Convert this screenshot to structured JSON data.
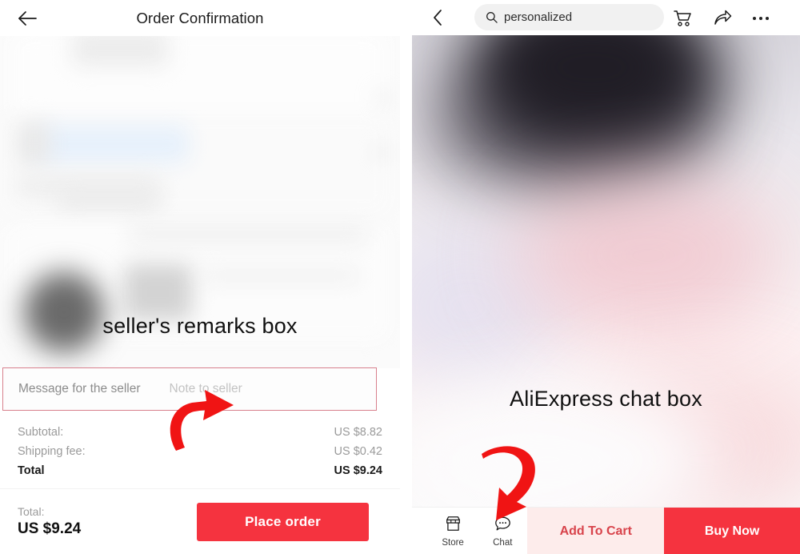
{
  "left_panel": {
    "header": {
      "back_icon": "back-arrow-icon",
      "title": "Order Confirmation"
    },
    "annotation_caption": "seller's remarks box",
    "note_field": {
      "label": "Message for the seller",
      "placeholder": "Note to seller",
      "value": "",
      "border_color": "#d8808d"
    },
    "totals": [
      {
        "label": "Subtotal:",
        "value": "US $8.82",
        "emphasis": false
      },
      {
        "label": "Shipping fee:",
        "value": "US $0.42",
        "emphasis": false
      },
      {
        "label": "Total",
        "value": "US $9.24",
        "emphasis": true
      }
    ],
    "footer": {
      "total_label": "Total:",
      "total_value": "US $9.24",
      "place_order_label": "Place order",
      "place_order_color": "#f5333f"
    },
    "arrow": {
      "name": "red-curved-arrow-up-right",
      "color": "#f01414"
    }
  },
  "right_panel": {
    "header": {
      "back_icon": "back-chevron-icon",
      "search": {
        "icon": "search-icon",
        "value": "personalized",
        "placeholder": "Search"
      },
      "cart_icon": "shopping-cart-icon",
      "share_icon": "share-icon",
      "more_icon": "more-options-icon"
    },
    "annotation_caption": "AliExpress chat box",
    "bottom_bar": {
      "store_icon": "store-icon",
      "store_label": "Store",
      "chat_icon": "chat-bubble-icon",
      "chat_label": "Chat",
      "add_to_cart_label": "Add To Cart",
      "add_to_cart_color": "#fdeceb",
      "add_to_cart_text_color": "#d8434b",
      "buy_now_label": "Buy Now",
      "buy_now_color": "#f5333f"
    },
    "arrow": {
      "name": "red-curved-arrow-down",
      "color": "#f01414"
    }
  }
}
